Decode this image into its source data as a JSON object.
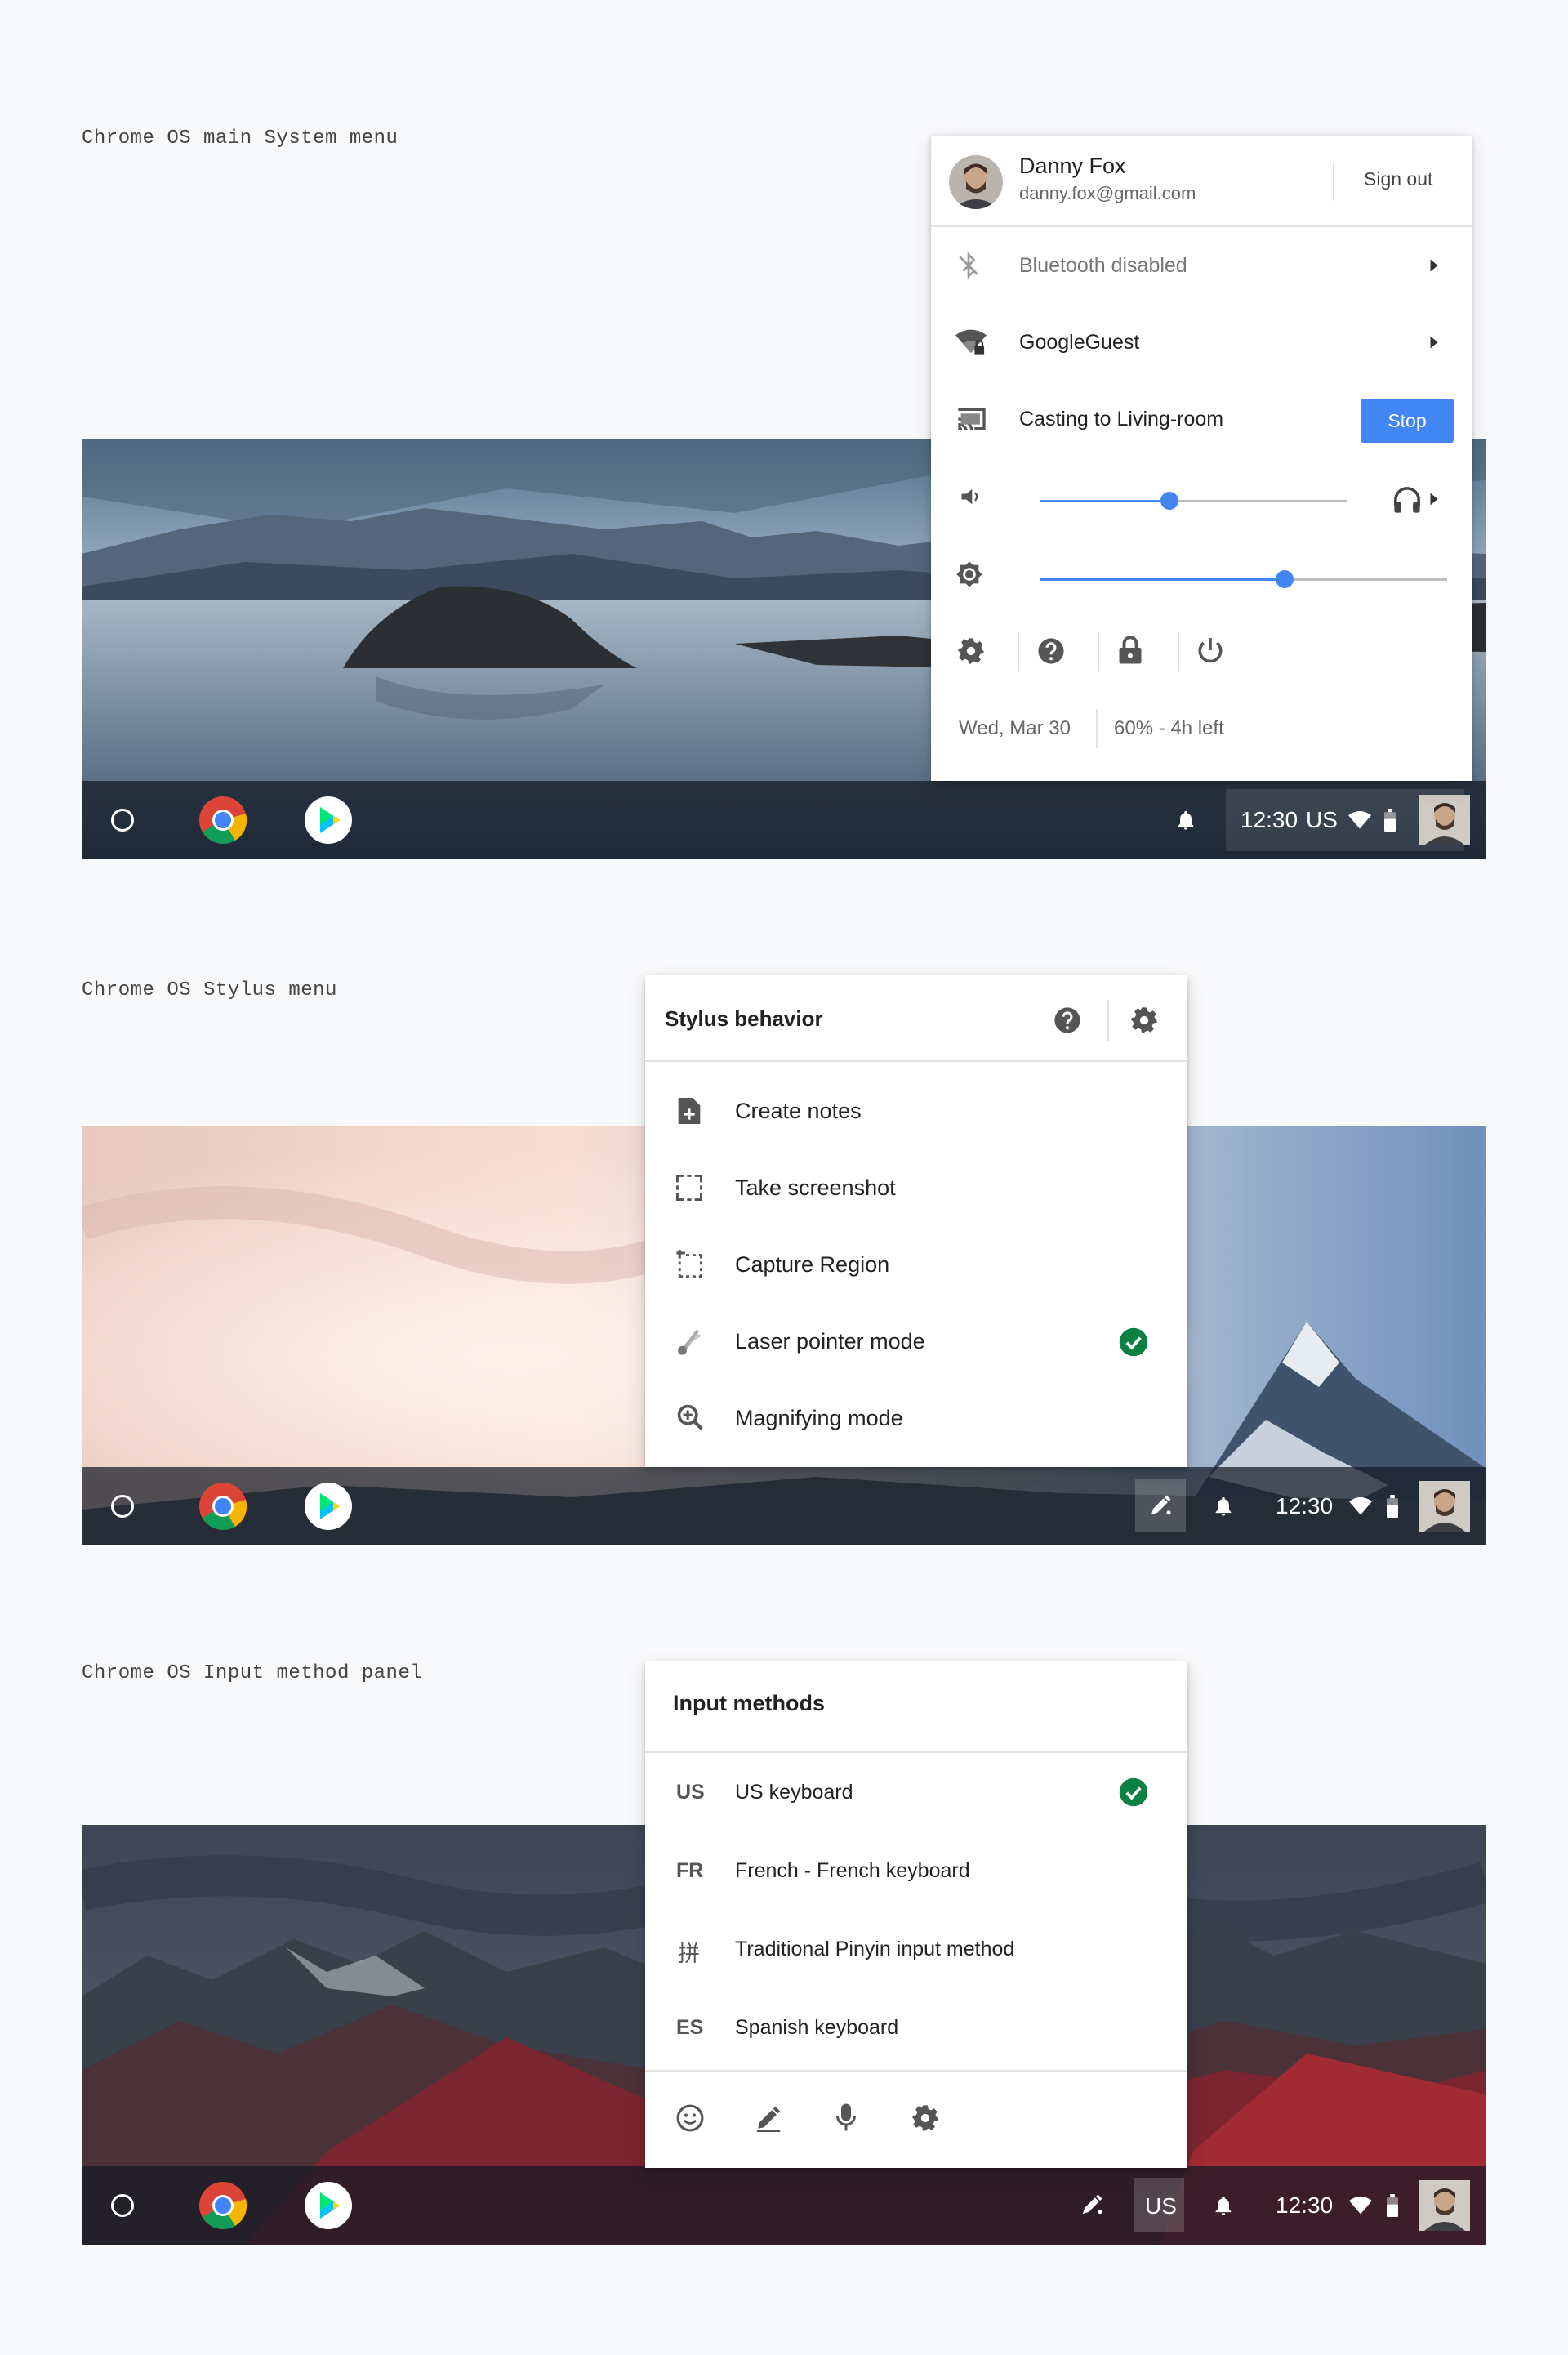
{
  "sections": {
    "system": {
      "caption": "Chrome OS main System menu"
    },
    "stylus": {
      "caption": "Chrome OS Stylus menu"
    },
    "ime": {
      "caption": "Chrome OS Input method panel"
    }
  },
  "system_menu": {
    "user_name": "Danny Fox",
    "user_email": "danny.fox@gmail.com",
    "sign_out": "Sign out",
    "bluetooth": "Bluetooth disabled",
    "network": "GoogleGuest",
    "casting": "Casting to Living-room",
    "stop": "Stop",
    "volume_level": 0.42,
    "brightness_level": 0.6,
    "date": "Wed, Mar 30",
    "battery": "60% - 4h left"
  },
  "stylus_menu": {
    "title": "Stylus behavior",
    "items": [
      {
        "label": "Create notes",
        "icon": "note-add-icon",
        "selected": false
      },
      {
        "label": "Take screenshot",
        "icon": "screenshot-icon",
        "selected": false
      },
      {
        "label": "Capture Region",
        "icon": "capture-region-icon",
        "selected": false
      },
      {
        "label": "Laser pointer mode",
        "icon": "laser-pointer-icon",
        "selected": true
      },
      {
        "label": "Magnifying mode",
        "icon": "magnify-icon",
        "selected": false
      }
    ]
  },
  "ime_menu": {
    "title": "Input methods",
    "items": [
      {
        "code": "US",
        "label": "US keyboard",
        "selected": true
      },
      {
        "code": "FR",
        "label": "French - French keyboard",
        "selected": false
      },
      {
        "code": "拼",
        "label": "Traditional Pinyin input method",
        "selected": false
      },
      {
        "code": "ES",
        "label": "Spanish keyboard",
        "selected": false
      }
    ]
  },
  "shelf": {
    "time": "12:30",
    "ime_indicator": "US"
  },
  "colors": {
    "accent": "#4285f4",
    "check_green": "#0b8043",
    "page_bg": "#f8f9fb"
  }
}
